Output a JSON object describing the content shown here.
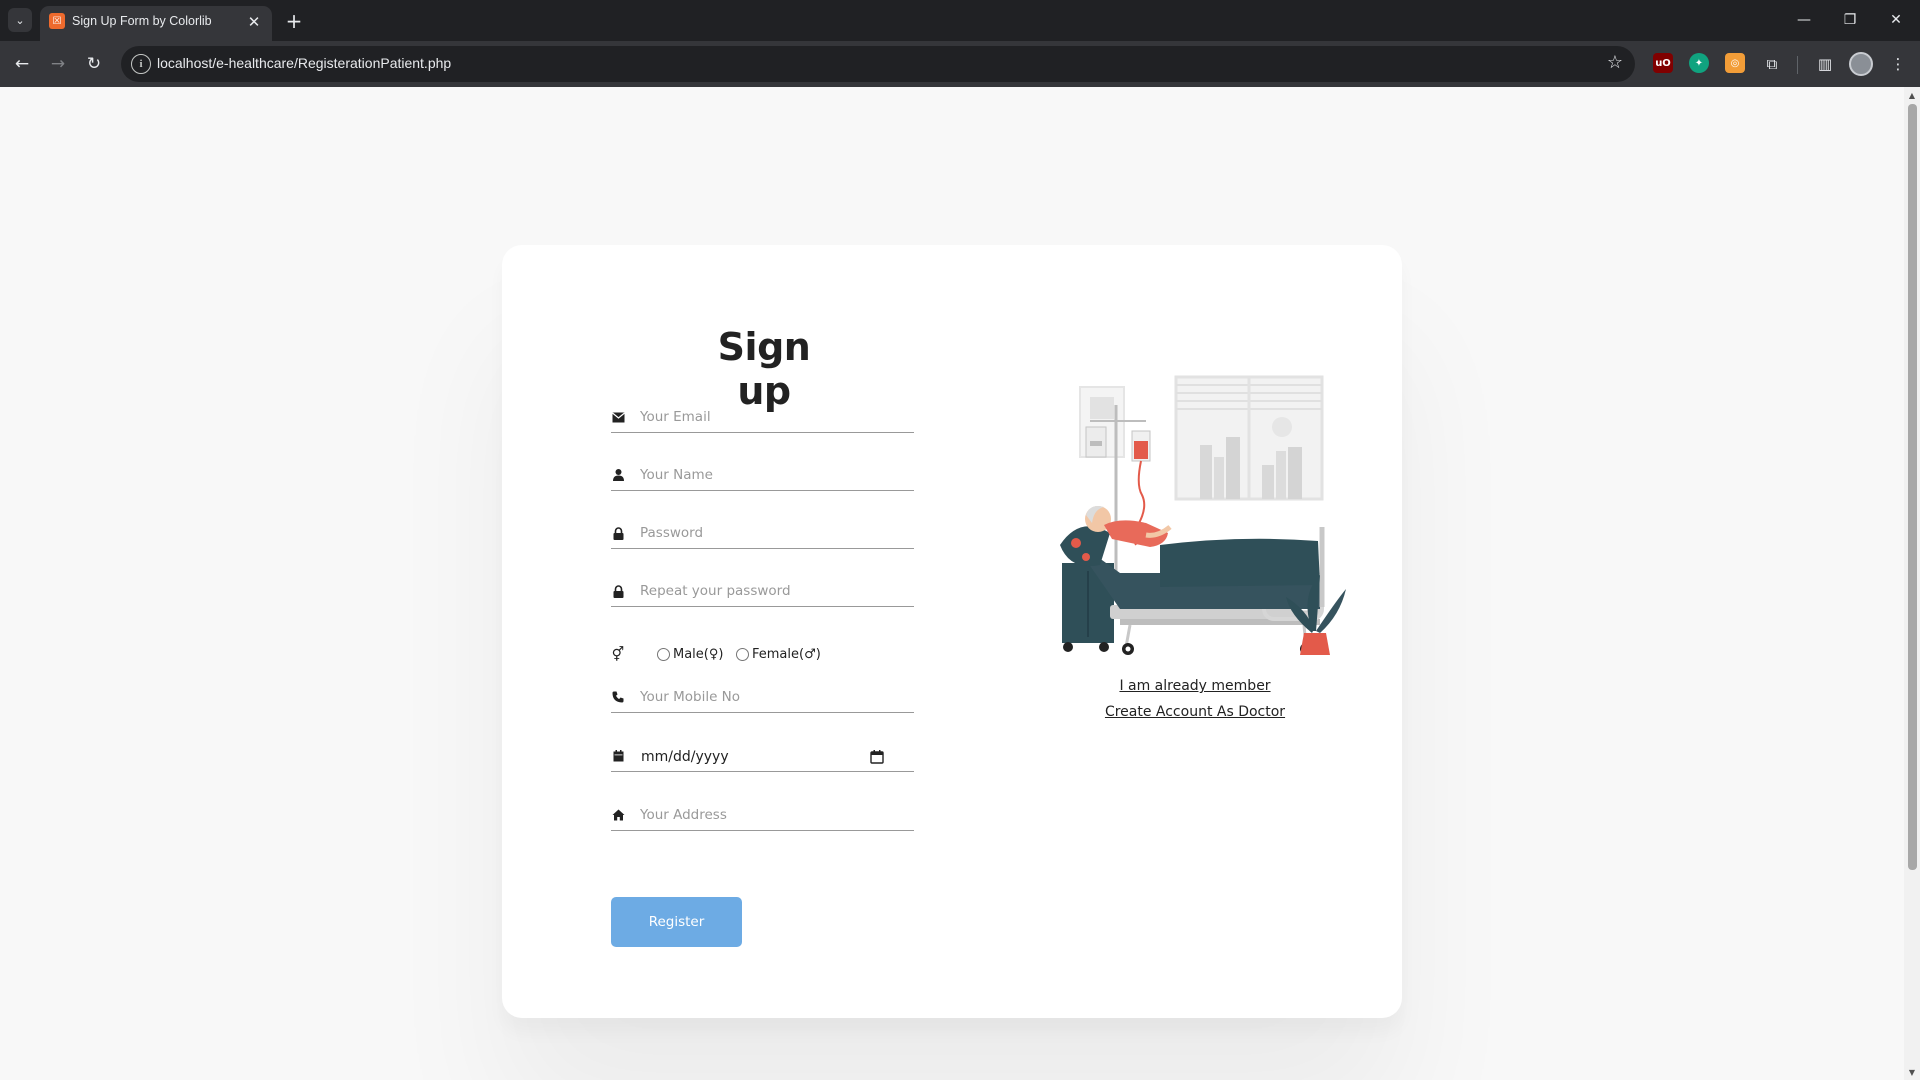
{
  "browser": {
    "tab_title": "Sign Up Form by Colorlib",
    "tab_favicon_letter": "☒",
    "url": "localhost/e-healthcare/RegisterationPatient.php",
    "extensions": [
      {
        "name": "ublock",
        "label": "uO",
        "color": "#800000"
      },
      {
        "name": "chatgpt",
        "label": "✦",
        "color": "#10a37f"
      },
      {
        "name": "orange-ext",
        "label": "◎",
        "color": "#f29d38"
      }
    ]
  },
  "form": {
    "title": "Sign up",
    "email_placeholder": "Your Email",
    "name_placeholder": "Your Name",
    "password_placeholder": "Password",
    "repeat_password_placeholder": "Repeat your password",
    "gender_male_label": "Male(♀)",
    "gender_female_label": "Female(♂)",
    "mobile_placeholder": "Your Mobile No",
    "date_value": "mm/dd/yyyy",
    "address_placeholder": "Your Address",
    "register_label": "Register"
  },
  "links": {
    "member": "I am already member",
    "doctor": "Create Account As Doctor"
  },
  "icons": {
    "email": "envelope-icon",
    "name": "user-icon",
    "password": "lock-icon",
    "gender": "gender-icon",
    "mobile": "phone-icon",
    "date": "calendar-icon",
    "address": "home-icon"
  },
  "colors": {
    "register_button": "#6dabe4",
    "page_background": "#f8f8f8",
    "browser_frame": "#202124"
  }
}
